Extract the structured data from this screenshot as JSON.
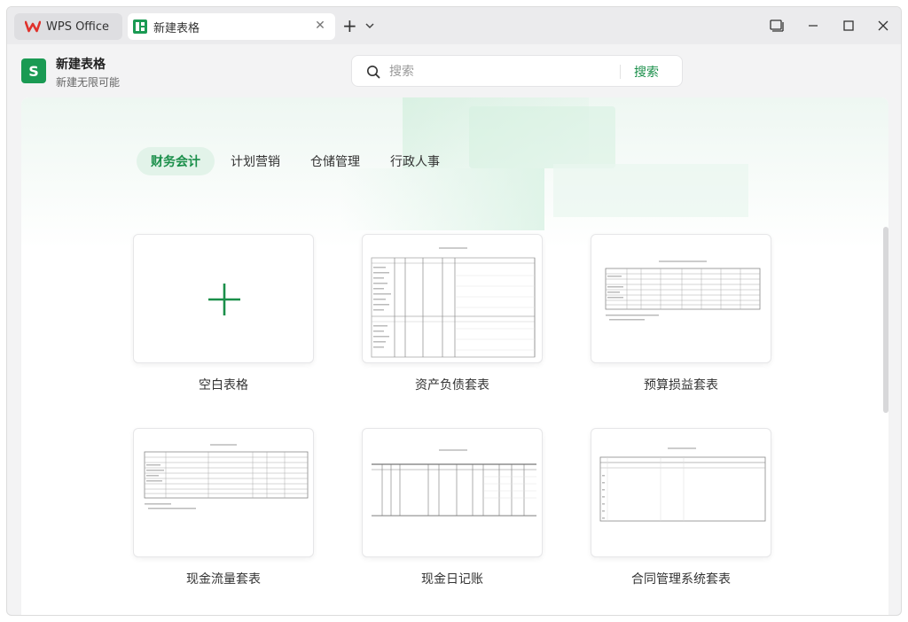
{
  "tabs": {
    "home_label": "WPS Office",
    "doc_label": "新建表格"
  },
  "header": {
    "icon_letter": "S",
    "title": "新建表格",
    "subtitle": "新建无限可能"
  },
  "search": {
    "placeholder": "搜索",
    "button_label": "搜索"
  },
  "categories": [
    "财务会计",
    "计划营销",
    "仓储管理",
    "行政人事"
  ],
  "active_category": "财务会计",
  "templates": [
    {
      "label": "空白表格"
    },
    {
      "label": "资产负债套表"
    },
    {
      "label": "预算损益套表"
    },
    {
      "label": "现金流量套表"
    },
    {
      "label": "现金日记账"
    },
    {
      "label": "合同管理系统套表"
    }
  ],
  "colors": {
    "accent": "#1a8f4a",
    "app_icon": "#1a9a53",
    "wps_logo": "#e0312b"
  }
}
